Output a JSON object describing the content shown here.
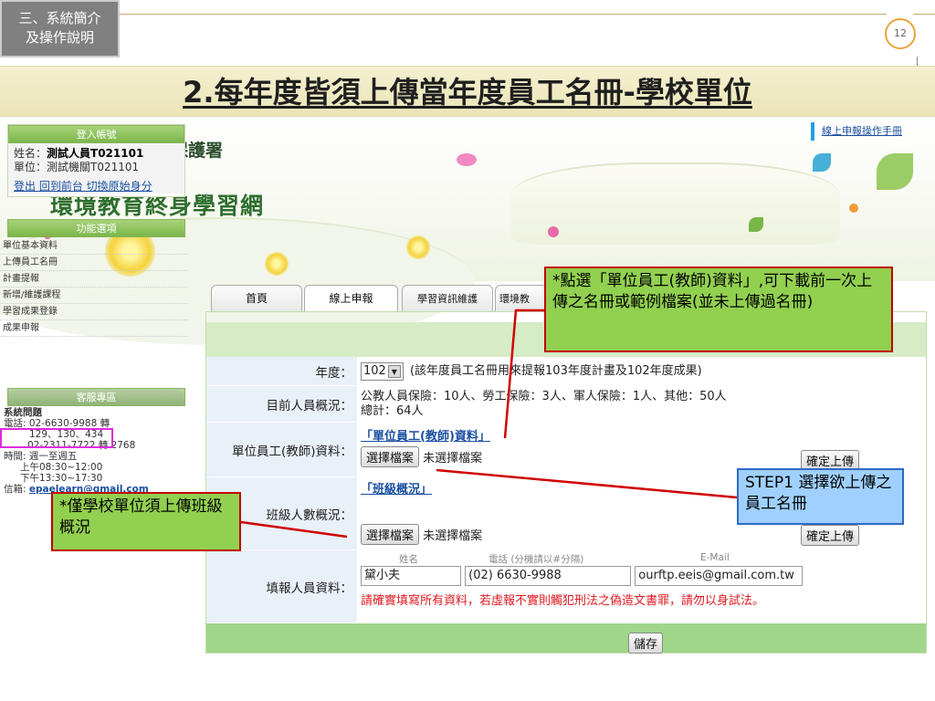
{
  "slide": {
    "section_label_line1": "三、系統簡介",
    "section_label_line2": "及操作說明",
    "page_number": "12",
    "title": "2.每年度皆須上傳當年度員工名冊-學校單位"
  },
  "site": {
    "org_name": "行政院環境保護署",
    "site_name": "環境教育終身學習網",
    "manual_link": "線上申報操作手冊"
  },
  "login": {
    "header": "登入帳號",
    "name_label": "姓名：",
    "name_value": "測試人員T021101",
    "unit_label": "單位：",
    "unit_value": "測試機關T021101",
    "links": "登出 回到前台 切換原始身分"
  },
  "menu": {
    "header": "功能選項",
    "items": [
      {
        "label": "單位基本資料"
      },
      {
        "label": "上傳員工名冊"
      },
      {
        "label": "計畫提報"
      },
      {
        "label": "新增/維護課程"
      },
      {
        "label": "學習成果登錄"
      },
      {
        "label": "成果申報"
      }
    ]
  },
  "service": {
    "header": "客服專區",
    "title": "系統問題",
    "phone1": "電話: 02-6630-9988 轉",
    "phone1_ext": "129、130、434",
    "phone2": "02-2311-7722 轉 2768",
    "hours_label": "時間: 週一至週五",
    "hours_am": "上午08:30~12:00",
    "hours_pm": "下午13:30~17:30",
    "mail_label": "信箱: ",
    "mail": "epaelearn@gmail.com"
  },
  "tabs": [
    {
      "label": "首頁"
    },
    {
      "label": "線上申報"
    },
    {
      "label": "學習資訊維護"
    },
    {
      "label": "環境教"
    }
  ],
  "form": {
    "year_label": "年度：",
    "year_value": "102",
    "year_note": "(該年度員工名冊用來提報103年度計畫及102年度成果)",
    "people_label": "目前人員概況：",
    "people_line1": "公教人員保險：10人、勞工保險：3人、軍人保險：1人、其他：50人",
    "people_line2": "總計：64人",
    "staff_label": "單位員工(教師)資料：",
    "staff_link": "「單位員工(教師)資料」",
    "choose_file": "選擇檔案",
    "no_file": "未選擇檔案",
    "confirm_upload": "確定上傳",
    "class_label": "班級人數概況：",
    "class_link": "「班級概況」",
    "contact_label": "填報人員資料：",
    "col_name": "姓名",
    "col_phone": "電話 (分機請以#分隔)",
    "col_email": "E-Mail",
    "name_value": "黛小夫",
    "phone_value": "(02) 6630-9988",
    "email_value": "ourftp.eeis@gmail.com.tw",
    "warning": "請確實填寫所有資料，若虛報不實則觸犯刑法之偽造文書罪，請勿以身試法。",
    "save": "儲存"
  },
  "callouts": {
    "top": "*點選「單位員工(教師)資料」,可下載前一次上傳之名冊或範例檔案(並未上傳過名冊)",
    "step": "STEP1 選擇欲上傳之員工名冊",
    "class": "*僅學校單位須上傳班級概況"
  },
  "colors": {
    "callout_green": "#92d050",
    "callout_blue": "#9fd0ff",
    "arrow_red": "#d00000",
    "highlight_magenta": "#e02ae0",
    "title_band": "#f4f0cf"
  }
}
